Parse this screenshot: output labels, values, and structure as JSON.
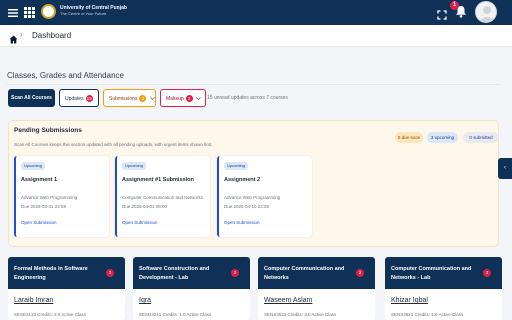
{
  "header": {
    "brand_name": "University of Central Punjab",
    "brand_tagline": "The Centre of Your Future",
    "notification_count": "1",
    "menu_icon": "hamburger-icon",
    "apps_icon": "grid-icon",
    "fullscreen_icon": "fullscreen-icon",
    "bell_icon": "bell-icon",
    "brand_color": "#0f3057"
  },
  "breadcrumb": {
    "separator": "›",
    "current": "Dashboard"
  },
  "section": {
    "title": "Classes, Grades and Attendance"
  },
  "filters": {
    "scan_label": "Scan All Courses",
    "updates_label": "Updates",
    "updates_count": "15",
    "submissions_label": "Submissions",
    "submissions_count": "3",
    "makeup_label": "Makeup",
    "makeup_count": "2",
    "note": "15 unread updates across 7 courses"
  },
  "pending": {
    "title": "Pending Submissions",
    "description": "Scan All Courses keeps this section updated with all pending uploads, with urgent items shown first.",
    "due_soon": "0 due soon",
    "upcoming": "3 upcoming",
    "submitted": "0 submitted",
    "items": [
      {
        "badge": "Upcoming",
        "title": "Assignment 1",
        "course": "Advance Web Programming",
        "due": "Due 2026-03-31 23:59",
        "link": "Open Submission"
      },
      {
        "badge": "Upcoming",
        "title": "Assignment #1 Submission",
        "course": "Computer Communication and Networks",
        "due": "Due 2026-04-01 09:00",
        "link": "Open Submission"
      },
      {
        "badge": "Upcoming",
        "title": "Assignment 2",
        "course": "Advance Web Programming",
        "due": "Due 2026-04-10 23:59",
        "link": "Open Submission"
      }
    ]
  },
  "side_toggle": "‹",
  "courses": [
    {
      "name": "Formal Methods in Software Engineering",
      "count": "3",
      "teacher": "Laraib Imran",
      "meta": "SESE3133 Credits: 3.0 Active Class"
    },
    {
      "name": "Software Construction and Development - Lab",
      "count": "2",
      "teacher": "Iqra",
      "meta": "SESD3241 Credits: 1.0 Active Class"
    },
    {
      "name": "Computer Communication and Networks",
      "count": "2",
      "teacher": "Waseem Aslam",
      "meta": "SENS3523 Credits: 3.0 Active Class"
    },
    {
      "name": "Computer Communication and Networks - Lab",
      "count": "3",
      "teacher": "Khizar Iqbal",
      "meta": "SENS3521 Credits: 1.0 Active Class"
    }
  ]
}
